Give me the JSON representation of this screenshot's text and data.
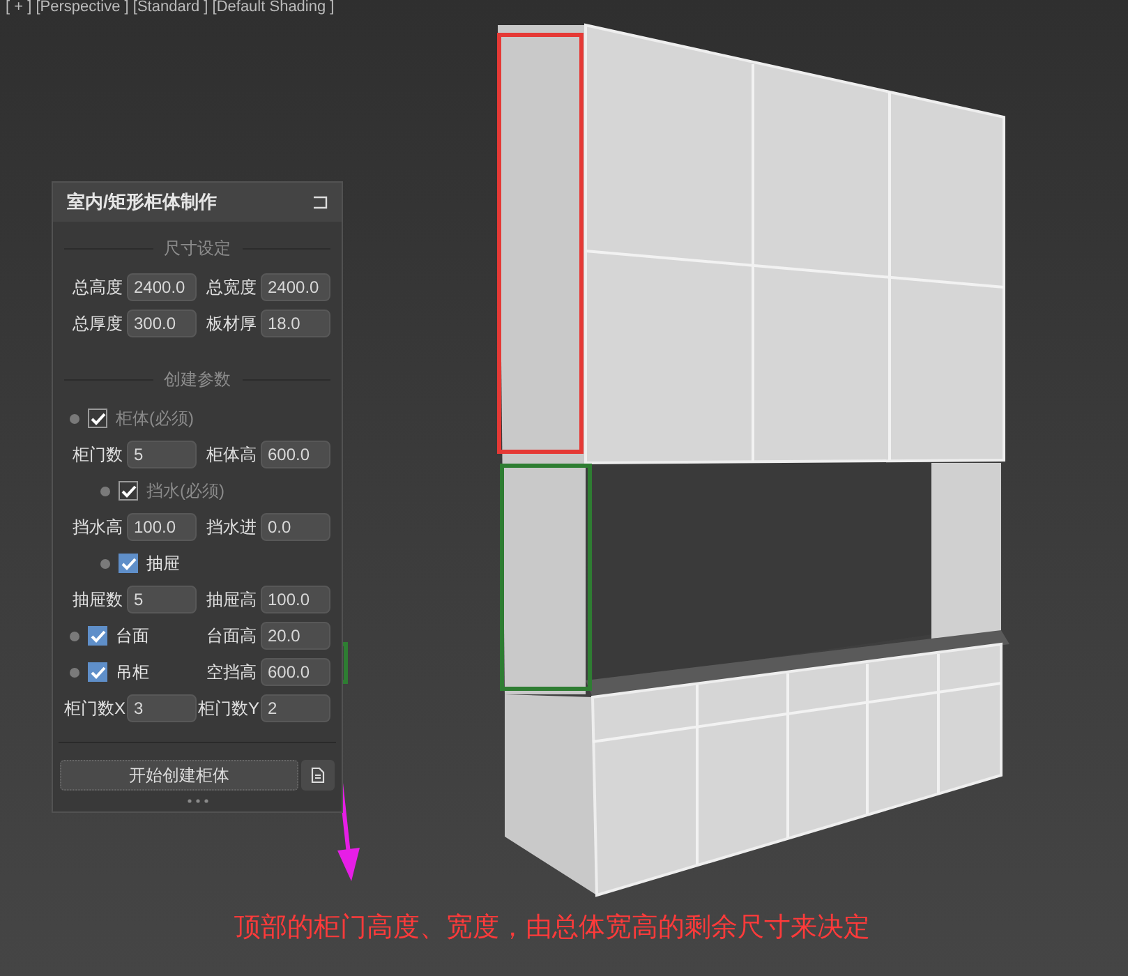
{
  "viewport_label": "[ + ] [Perspective ] [Standard ] [Default Shading ]",
  "panel": {
    "title": "室内/矩形柜体制作",
    "sections": [
      {
        "title": "尺寸设定",
        "rows": [
          {
            "kind": "fields",
            "fields": [
              {
                "label": "总高度",
                "value": "2400.0"
              },
              {
                "label": "总宽度",
                "value": "2400.0"
              }
            ]
          },
          {
            "kind": "fields",
            "fields": [
              {
                "label": "总厚度",
                "value": "300.0"
              },
              {
                "label": "板材厚",
                "value": "18.0"
              }
            ]
          }
        ]
      },
      {
        "title": "创建参数",
        "rows": [
          {
            "kind": "toggle",
            "label": "柜体(必须)",
            "checked": true,
            "disabled": true
          },
          {
            "kind": "fields",
            "fields": [
              {
                "label": "柜门数",
                "value": "5"
              },
              {
                "label": "柜体高",
                "value": "600.0"
              }
            ]
          },
          {
            "kind": "subtoggle",
            "label": "挡水(必须)",
            "checked": true,
            "disabled": true
          },
          {
            "kind": "fields",
            "fields": [
              {
                "label": "挡水高",
                "value": "100.0"
              },
              {
                "label": "挡水进",
                "value": "0.0"
              }
            ]
          },
          {
            "kind": "subtoggle",
            "label": "抽屉",
            "checked": true,
            "disabled": false
          },
          {
            "kind": "fields",
            "fields": [
              {
                "label": "抽屉数",
                "value": "5"
              },
              {
                "label": "抽屉高",
                "value": "100.0"
              }
            ]
          },
          {
            "kind": "toggle_field",
            "label": "台面",
            "checked": true,
            "disabled": false,
            "field": {
              "label": "台面高",
              "value": "20.0"
            }
          },
          {
            "kind": "toggle_field",
            "label": "吊柜",
            "checked": true,
            "disabled": false,
            "field": {
              "label": "空挡高",
              "value": "600.0"
            }
          },
          {
            "kind": "fields",
            "fields": [
              {
                "label": "柜门数X",
                "value": "3"
              },
              {
                "label": "柜门数Y",
                "value": "2"
              }
            ]
          }
        ]
      }
    ],
    "button": "开始创建柜体"
  },
  "caption": "顶部的柜门高度、宽度，由总体宽高的剩余尺寸来决定"
}
